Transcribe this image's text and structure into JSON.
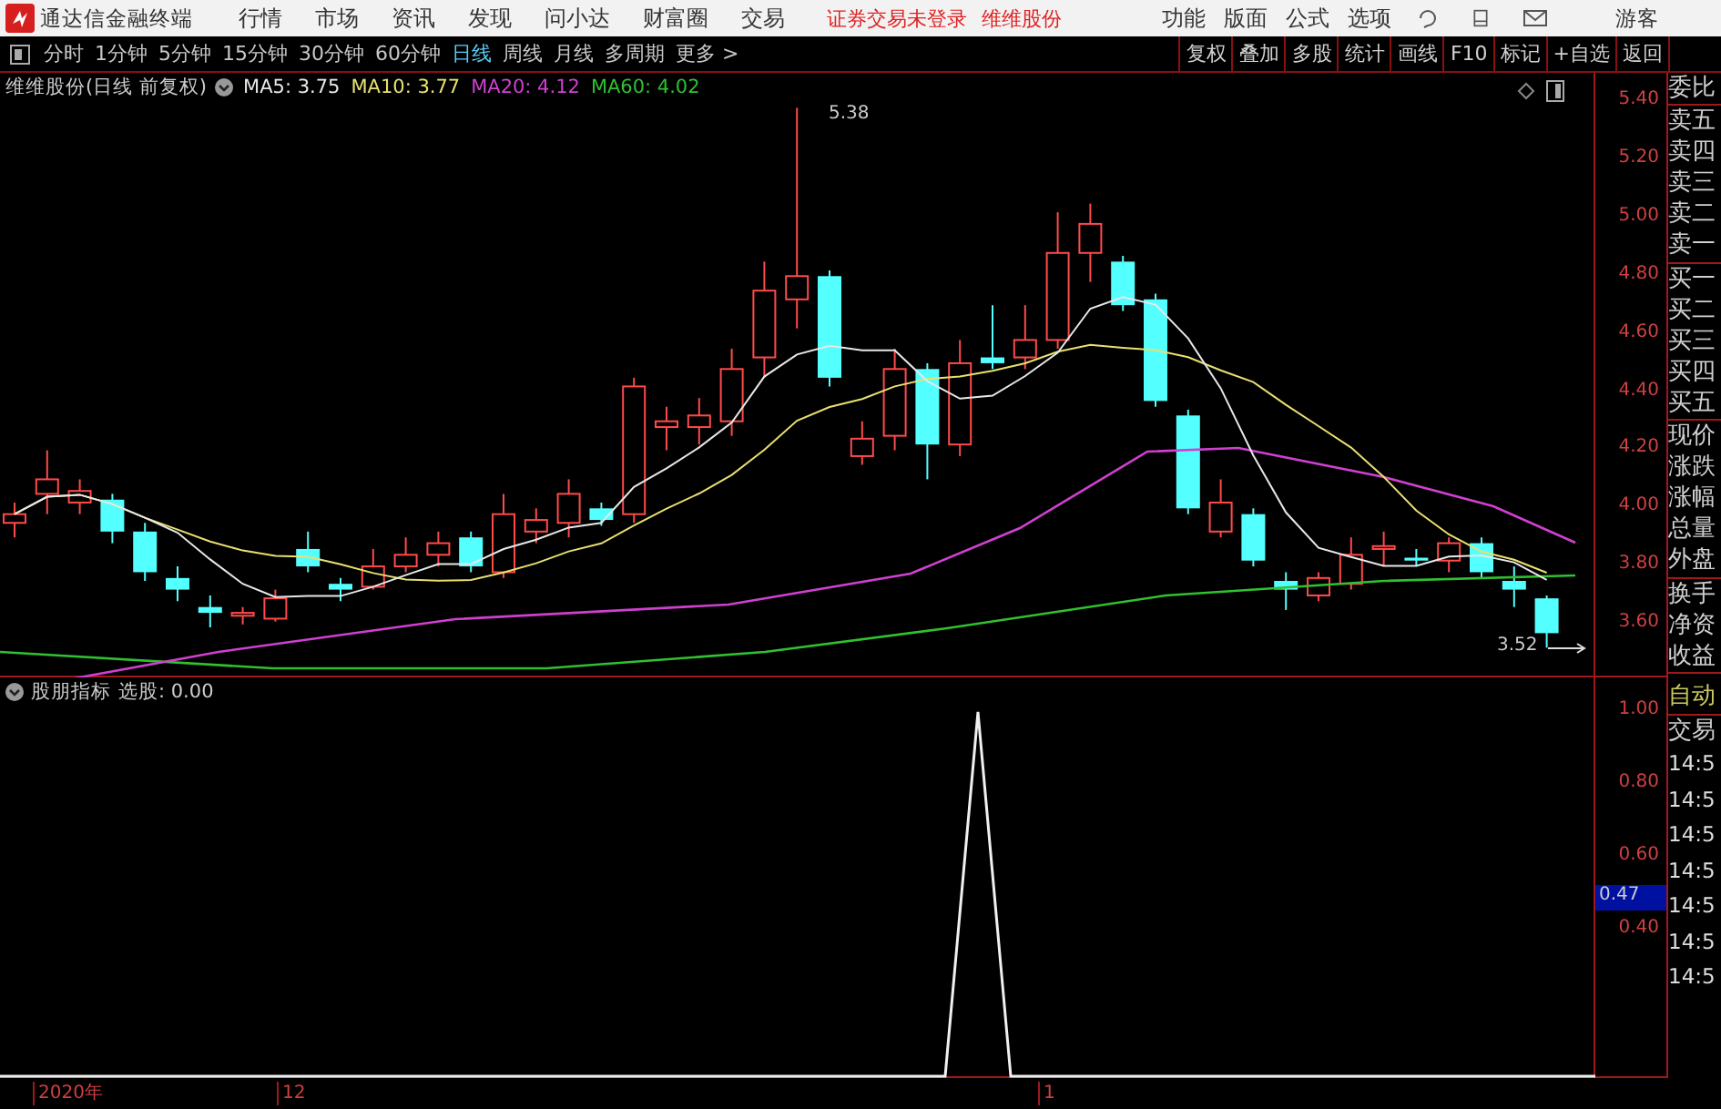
{
  "app_title": "通达信金融终端",
  "menus": [
    "行情",
    "市场",
    "资讯",
    "发现",
    "问小达",
    "财富圈",
    "交易"
  ],
  "login_status": "证券交易未登录",
  "stock_link": "维维股份",
  "right_menus": [
    "功能",
    "版面",
    "公式",
    "选项"
  ],
  "user": "游客",
  "periods": [
    {
      "label": "分时",
      "selected": false
    },
    {
      "label": "1分钟",
      "selected": false
    },
    {
      "label": "5分钟",
      "selected": false
    },
    {
      "label": "15分钟",
      "selected": false
    },
    {
      "label": "30分钟",
      "selected": false
    },
    {
      "label": "60分钟",
      "selected": false
    },
    {
      "label": "日线",
      "selected": true
    },
    {
      "label": "周线",
      "selected": false
    },
    {
      "label": "月线",
      "selected": false
    },
    {
      "label": "多周期",
      "selected": false
    },
    {
      "label": "更多 >",
      "selected": false
    }
  ],
  "tool_buttons": [
    "复权",
    "叠加",
    "多股",
    "统计",
    "画线",
    "F10",
    "标记",
    "+自选",
    "返回"
  ],
  "chart_title": "维维股份(日线 前复权)",
  "ma_values": [
    {
      "label": "MA5: 3.75",
      "color": "#e8e8e8"
    },
    {
      "label": "MA10: 3.77",
      "color": "#e8e070"
    },
    {
      "label": "MA20: 4.12",
      "color": "#d040d0"
    },
    {
      "label": "MA60: 4.02",
      "color": "#30c030"
    }
  ],
  "high_label": "5.38",
  "low_label": "3.52",
  "price_axis": [
    "5.40",
    "5.20",
    "5.00",
    "4.80",
    "4.60",
    "4.40",
    "4.20",
    "4.00",
    "3.80",
    "3.60"
  ],
  "quote_labels": [
    [
      "委比"
    ],
    [
      "卖五",
      "卖四",
      "卖三",
      "卖二",
      "卖一"
    ],
    [
      "买一",
      "买二",
      "买三",
      "买四",
      "买五"
    ],
    [
      "现价",
      "涨跌",
      "涨幅",
      "总量",
      "外盘"
    ],
    [
      "换手",
      "净资",
      "收益"
    ]
  ],
  "indicator": {
    "name": "股朋指标",
    "value": "选股: 0.00",
    "axis": [
      "1.00",
      "0.80",
      "0.60",
      "0.40"
    ],
    "current": "0.47"
  },
  "auto_label": "自动",
  "trade_label": "交易",
  "trade_times": [
    "14:5",
    "14:5",
    "14:5",
    "14:5",
    "14:5",
    "14:5",
    "14:5"
  ],
  "x_axis": [
    "2020年",
    "12",
    "1"
  ]
}
